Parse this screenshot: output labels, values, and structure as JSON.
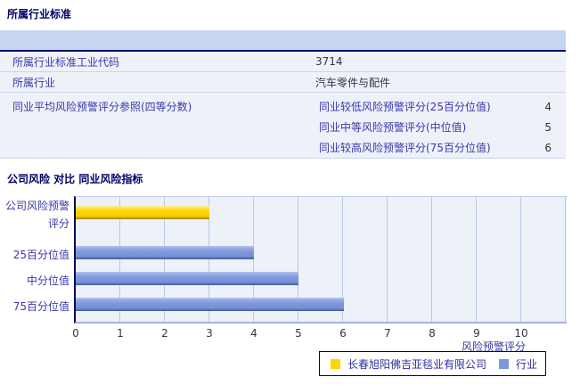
{
  "section1": {
    "title": "所属行业标准",
    "rows": [
      {
        "label": "所属行业标准工业代码",
        "value": "3714"
      },
      {
        "label": "所属行业",
        "value": "汽车零件与配件"
      }
    ],
    "quartile_row": {
      "label": "同业平均风险预警评分参照(四等分数)",
      "subrows": [
        {
          "label": "同业较低风险预警评分(25百分位值)",
          "value": "4"
        },
        {
          "label": "同业中等风险预警评分(中位值)",
          "value": "5"
        },
        {
          "label": "同业较高风险预警评分(75百分位值)",
          "value": "6"
        }
      ]
    }
  },
  "section2": {
    "title": "公司风险 对比 同业风险指标"
  },
  "chart_data": {
    "type": "bar",
    "orientation": "horizontal",
    "title": "公司风险 对比 同业风险指标",
    "categories": [
      "公司风险预警评分",
      "25百分位值",
      "中分位值",
      "75百分位值"
    ],
    "series": [
      {
        "name": "长春旭阳佛吉亚毯业有限公司",
        "color": "#ffd400",
        "values": [
          3,
          null,
          null,
          null
        ]
      },
      {
        "name": "行业",
        "color": "#7d97dc",
        "values": [
          null,
          4,
          5,
          6
        ]
      }
    ],
    "xlabel": "风险预警评分",
    "xlim": [
      0,
      11
    ],
    "ticks": [
      "0",
      "1",
      "2",
      "3",
      "4",
      "5",
      "6",
      "7",
      "8",
      "9",
      "10"
    ],
    "grid": true,
    "legend_position": "bottom"
  },
  "colors": {
    "header_band": "#c6d6ee",
    "row_bg": "#eef1f8",
    "accent_navy": "#000066",
    "company_bar": "#ffd400",
    "industry_bar": "#7d97dc"
  }
}
